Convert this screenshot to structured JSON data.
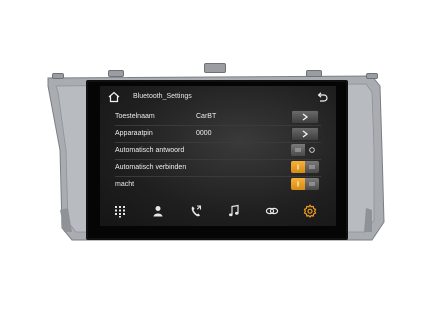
{
  "screen": {
    "title": "Bluetooth_Settings"
  },
  "settings": [
    {
      "label": "Toestelnaam",
      "value": "CarBT",
      "control": "arrow"
    },
    {
      "label": "Apparaatpin",
      "value": "0000",
      "control": "arrow"
    },
    {
      "label": "Automatisch antwoord",
      "value": "",
      "control": "toggle",
      "on": false
    },
    {
      "label": "Automatisch verbinden",
      "value": "",
      "control": "toggle",
      "on": true
    },
    {
      "label": "macht",
      "value": "",
      "control": "toggle",
      "on": true
    }
  ],
  "navbar": {
    "items": [
      "dialpad-icon",
      "contacts-icon",
      "call-log-icon",
      "music-icon",
      "link-icon",
      "settings-icon"
    ],
    "active": "settings-icon"
  },
  "colors": {
    "accent": "#f0a020",
    "bezel": "#a7abb0",
    "screen_bg": "#1e1e1e"
  }
}
